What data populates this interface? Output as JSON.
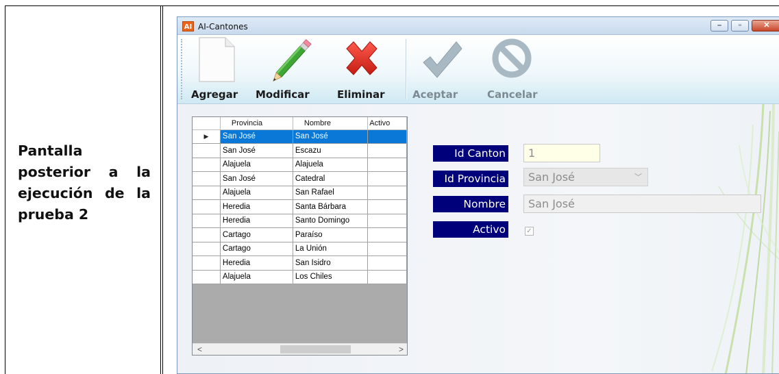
{
  "document": {
    "left_cell_text": "Pantalla posterior a la ejecución de la prueba 2"
  },
  "window": {
    "icon_text": "AI",
    "title": "AI-Cantones",
    "controls": {
      "minimize": "–",
      "maximize": "▫",
      "close": "✕"
    }
  },
  "toolbar": {
    "buttons": [
      {
        "label": "Agregar",
        "icon": "new-document-icon",
        "enabled": true
      },
      {
        "label": "Modificar",
        "icon": "pencil-icon",
        "enabled": true
      },
      {
        "label": "Eliminar",
        "icon": "red-x-icon",
        "enabled": true
      },
      {
        "label": "Aceptar",
        "icon": "checkmark-icon",
        "enabled": false
      },
      {
        "label": "Cancelar",
        "icon": "cancel-circle-icon",
        "enabled": false
      }
    ]
  },
  "grid": {
    "columns": [
      "Provincia",
      "Nombre",
      "Activo"
    ],
    "selected_row": 0,
    "current_row_marker": "▶",
    "rows": [
      [
        "San José",
        "San José"
      ],
      [
        "San José",
        "Escazu"
      ],
      [
        "Alajuela",
        "Alajuela"
      ],
      [
        "San José",
        "Catedral"
      ],
      [
        "Alajuela",
        "San Rafael"
      ],
      [
        "Heredia",
        "Santa Bárbara"
      ],
      [
        "Heredia",
        "Santo Domingo"
      ],
      [
        "Cartago",
        "Paraíso"
      ],
      [
        "Cartago",
        "La Unión"
      ],
      [
        "Heredia",
        "San Isidro"
      ],
      [
        "Alajuela",
        "Los Chiles"
      ]
    ],
    "scroll_left": "<",
    "scroll_right": ">"
  },
  "form": {
    "id_canton_label": "Id Canton",
    "id_canton_value": "1",
    "id_provincia_label": "Id Provincia",
    "id_provincia_value": "San José",
    "nombre_label": "Nombre",
    "nombre_value": "San José",
    "activo_label": "Activo",
    "activo_checked": true
  },
  "colors": {
    "label_background": "#00007a",
    "selection": "#0a78d7"
  }
}
